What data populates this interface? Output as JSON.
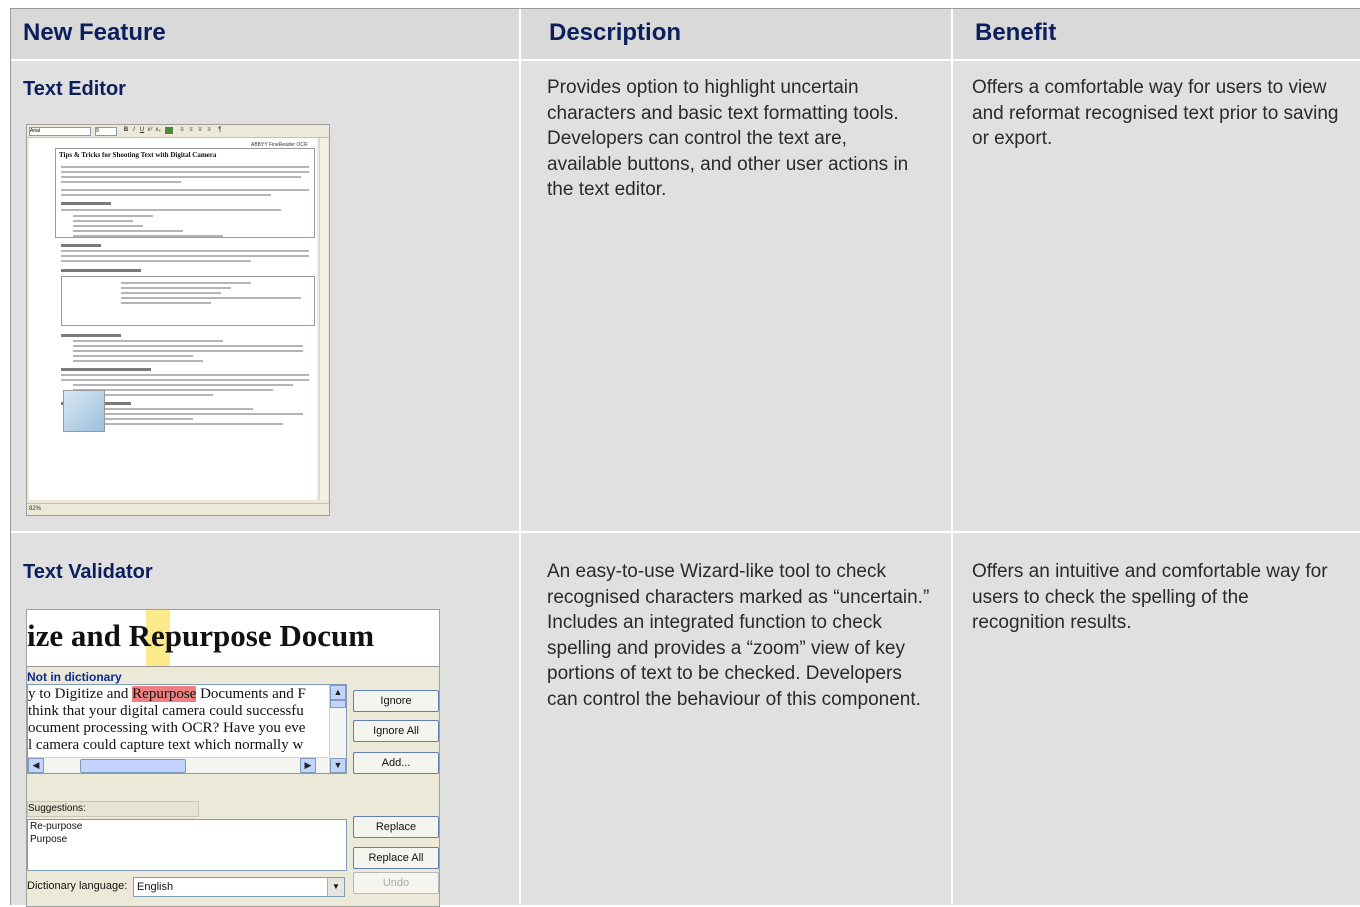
{
  "header": {
    "col1": "New Feature",
    "col2": "Description",
    "col3": "Benefit"
  },
  "rows": [
    {
      "feature": "Text Editor",
      "description": "Provides option to highlight uncertain characters and basic text formatting tools. Developers can control the text are, available buttons, and other user actions in the text editor.",
      "benefit": "Offers a comfortable way for users to view and reformat recognised text prior to saving or export."
    },
    {
      "feature": "Text Validator",
      "description": "An easy-to-use Wizard-like tool to check recognised characters marked as “uncertain.”  Includes an integrated function to check spelling and provides a “zoom” view of key portions of text to be checked. Developers can control the behaviour of this component.",
      "benefit": "Offers an intuitive and comfortable way for users to check the spelling of the recognition results."
    }
  ],
  "editor_shot": {
    "font_name": "Arial",
    "font_size": "9",
    "corner_text": "ABBYY FineReader OCR",
    "doc_title": "Tips & Tricks for Shooting Text with Digital Camera",
    "page_number": "2",
    "zoom": "82%"
  },
  "validator_shot": {
    "zoom_pre": "ize and ",
    "zoom_hl": "R",
    "zoom_post": "epurpose Docum",
    "not_in_dictionary": "Not in dictionary",
    "line1_pre": "y to Digitize and ",
    "line1_red": "Repurpose",
    "line1_post": " Documents and F",
    "line2": "think that your digital camera could successfu",
    "line3": "ocument processing with OCR? Have you eve",
    "line4": "l camera could capture text which normally w",
    "btn_ignore": "Ignore",
    "btn_ignore_all": "Ignore All",
    "btn_add": "Add...",
    "suggestions_label": "Suggestions:",
    "suggestions": [
      "Re-purpose",
      "Purpose"
    ],
    "btn_replace": "Replace",
    "btn_replace_all": "Replace All",
    "btn_undo": "Undo",
    "dictionary_language_label": "Dictionary language:",
    "dictionary_language": "English"
  }
}
